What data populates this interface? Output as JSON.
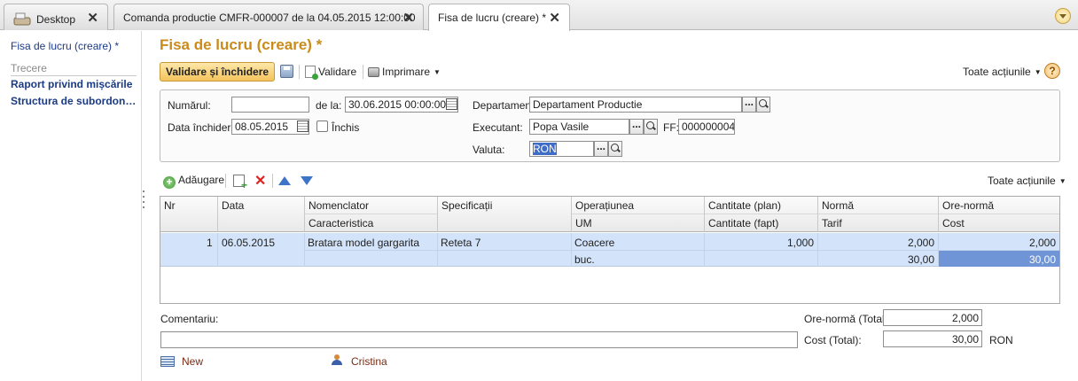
{
  "tabs": [
    {
      "label": "Desktop"
    },
    {
      "label": "Comanda productie CMFR-000007 de la 04.05.2015 12:00:00"
    },
    {
      "label": "Fisa de lucru (creare) *"
    }
  ],
  "left_panel": {
    "current": "Fisa de lucru (creare) *",
    "section": "Trecere",
    "links": [
      "Raport privind mișcările",
      "Structura de subordon…"
    ]
  },
  "form": {
    "title": "Fisa de lucru (creare) *",
    "toolbar": {
      "primary": "Validare și închidere",
      "validate": "Validare",
      "print": "Imprimare",
      "all_actions": "Toate acțiunile",
      "help": "?"
    },
    "header": {
      "number_label": "Numărul:",
      "number_value": "",
      "from_label": "de la:",
      "from_value": "30.06.2015 00:00:00",
      "close_date_label": "Data închiderii:",
      "close_date_value": "08.05.2015",
      "closed_label": "Închis",
      "department_label": "Departament:",
      "department_value": "Departament Productie",
      "executor_label": "Executant:",
      "executor_value": "Popa Vasile",
      "ff_label": "FF:",
      "ff_value": "000000004",
      "currency_label": "Valuta:",
      "currency_value": "RON"
    },
    "table_toolbar": {
      "add": "Adăugare",
      "all_actions": "Toate acțiunile"
    },
    "table": {
      "headers": [
        {
          "top": "Nr",
          "bottom": ""
        },
        {
          "top": "Data",
          "bottom": ""
        },
        {
          "top": "Nomenclator",
          "bottom": "Caracteristica"
        },
        {
          "top": "Specificații",
          "bottom": ""
        },
        {
          "top": "Operațiunea",
          "bottom": "UM"
        },
        {
          "top": "Cantitate (plan)",
          "bottom": "Cantitate (fapt)"
        },
        {
          "top": "Normă",
          "bottom": "Tarif"
        },
        {
          "top": "Ore-normă",
          "bottom": "Cost"
        }
      ],
      "rows": [
        {
          "nr": "1",
          "data": "06.05.2015",
          "nomenclator": "Bratara model gargarita",
          "caracteristica": "",
          "specificatii": "Reteta 7",
          "operatiunea": "Coacere",
          "um": "buc.",
          "cantitate_plan": "1,000",
          "cantitate_fapt": "",
          "norma": "2,000",
          "tarif": "30,00",
          "ore_norma": "2,000",
          "cost": "30,00"
        }
      ]
    },
    "footer": {
      "comment_label": "Comentariu:",
      "comment_value": "",
      "hours_total_label": "Ore-normă (Total):",
      "hours_total_value": "2,000",
      "cost_total_label": "Cost (Total):",
      "cost_total_value": "30,00",
      "cost_currency": "RON",
      "status": "New",
      "author": "Cristina"
    }
  },
  "colors": {
    "title": "#c98b1a",
    "link": "#1a3a86",
    "row_highlight": "#d3e3f9",
    "selected_cell": "#6f95d6"
  }
}
